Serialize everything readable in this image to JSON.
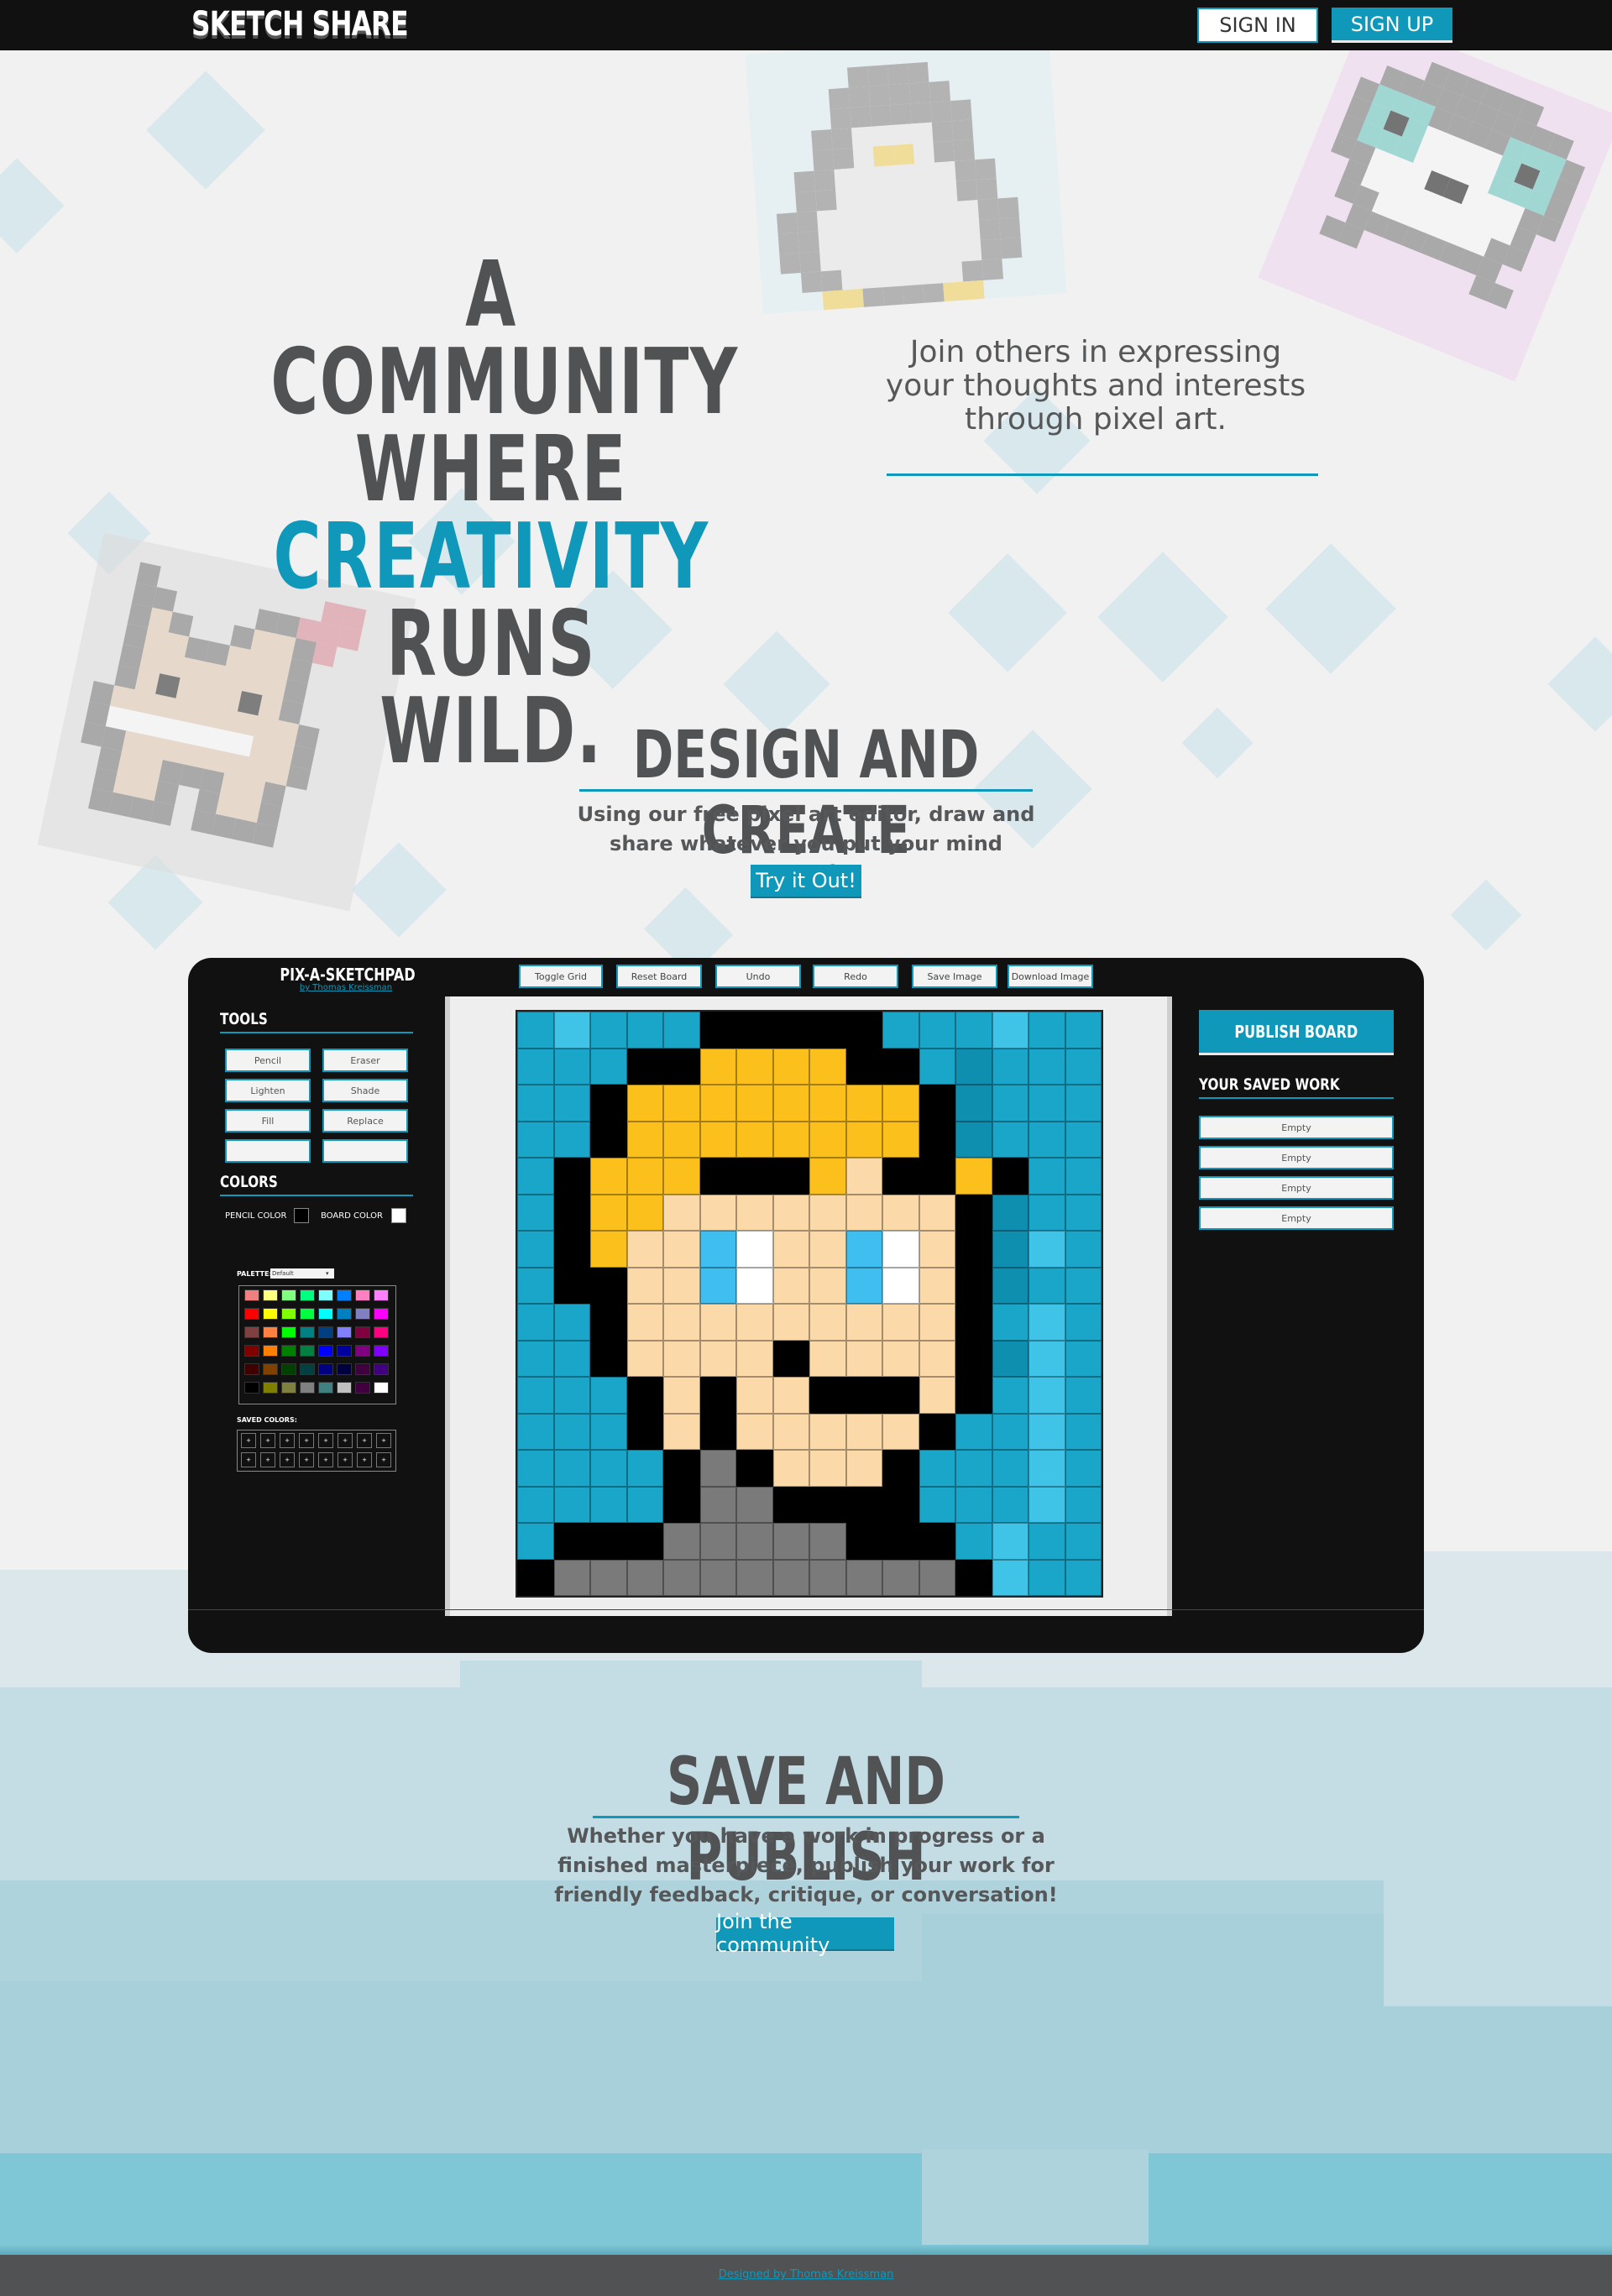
{
  "nav": {
    "logo": "SKETCH SHARE",
    "sign_in": "SIGN IN",
    "sign_up": "SIGN UP"
  },
  "hero": {
    "title_line1": "A COMMUNITY",
    "title_line2_a": "WHERE ",
    "title_line2_b": "CREATIVITY",
    "title_line3": "RUNS WILD.",
    "subtitle": "Join others in expressing your thoughts and interests through pixel art."
  },
  "design": {
    "title": "DESIGN AND CREATE",
    "text": "Using our free pixel art editor, draw and share whatever you put your mind towards.",
    "cta": "Try it Out!"
  },
  "app": {
    "title": "PIX-A-SKETCHPAD",
    "byline": "by Thomas Kreissman",
    "top_buttons": [
      "Toggle Grid",
      "Reset Board",
      "Undo",
      "Redo",
      "Save Image",
      "Download Image"
    ],
    "tools_heading": "TOOLS",
    "tools": [
      "Pencil",
      "Eraser",
      "Lighten",
      "Shade",
      "Fill",
      "Replace",
      "",
      ""
    ],
    "colors_heading": "COLORS",
    "pencil_color_label": "PENCIL COLOR",
    "board_color_label": "BOARD COLOR",
    "pencil_color": "#000000",
    "board_color": "#ffffff",
    "palette_label": "PALETTE:",
    "palette_selected": "Default",
    "saved_colors_label": "SAVED COLORS:",
    "saved_color_marker": "+",
    "publish_button": "PUBLISH BOARD",
    "saved_work_heading": "YOUR SAVED WORK",
    "saved_work": [
      "Empty",
      "Empty",
      "Empty",
      "Empty"
    ]
  },
  "publish": {
    "title": "SAVE AND PUBLISH",
    "text": "Whether you have a work in progress or a finished masterpiece, publish your work for friendly feedback, critique, or conversation!",
    "cta": "Join the community"
  },
  "footer": {
    "credit": "Designed by Thomas Kreissman"
  },
  "colors": {
    "accent": "#1098ba",
    "text": "#555759",
    "dark": "#111111"
  },
  "palette_colors": [
    "#f08080",
    "#ffff80",
    "#80ff80",
    "#00ff80",
    "#80ffff",
    "#0080ff",
    "#ff80c0",
    "#ff80ff",
    "#ff0000",
    "#ffff00",
    "#80ff00",
    "#00ff40",
    "#00ffff",
    "#0080c0",
    "#8080c0",
    "#ff00ff",
    "#804040",
    "#ff8040",
    "#00ff00",
    "#008080",
    "#004080",
    "#8080ff",
    "#800040",
    "#ff0080",
    "#800000",
    "#ff8000",
    "#008000",
    "#008040",
    "#0000ff",
    "#0000a0",
    "#800080",
    "#8000ff",
    "#400000",
    "#804000",
    "#004000",
    "#004040",
    "#000080",
    "#000040",
    "#400040",
    "#400080",
    "#000000",
    "#808000",
    "#808040",
    "#808080",
    "#408080",
    "#c0c0c0",
    "#400040",
    "#ffffff"
  ],
  "pixel_board": [
    "CLCCCKKKKKCCCLC",
    "CCCKKYYYYKKCDCC",
    "CCKYYYYYYYYKDCC",
    "CCKYYYYYYYYKDCC",
    "CKYYYKKKYFKKYKCC",
    "CKYYFFFFFFFFKDCC",
    "CKYFFBWFFBWFKDLC",
    "CKKFFBWFFBWFKDCC",
    "CCKFFFFFFFFFKCLC",
    "CCKFFFFKFFFFKDLC",
    "CCCKFKFFKKKFKCLC",
    "CCCKFKFFFFFKCCLC",
    "CCCCKGKFFFKCCCLC",
    "CCCCKGGKKKKCCCLC",
    "CKKKGGGGGKKKCLC",
    "KGGGGGGGGGGGKLC"
  ]
}
